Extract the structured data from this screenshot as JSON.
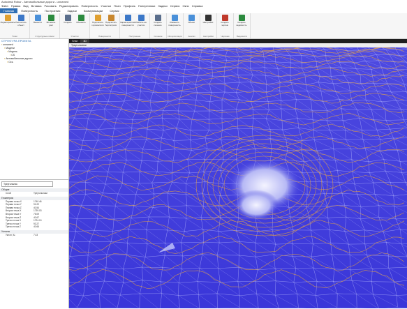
{
  "window": {
    "title": "Autodesk Robur - Автомобильные дороги - unnamed"
  },
  "menu": [
    "Файл",
    "Правка",
    "Вид",
    "Вставка",
    "Рисовать",
    "Редактировать",
    "Поверхность",
    "Участки",
    "План",
    "Профиль",
    "Поперечники",
    "Задачи",
    "Сервис",
    "Окно",
    "Справка"
  ],
  "ribbon_tabs": [
    {
      "label": "Главная",
      "active": true
    },
    {
      "label": "Поверхность",
      "active": false
    },
    {
      "label": "Построения",
      "active": false
    },
    {
      "label": "Задачи",
      "active": false
    },
    {
      "label": "Коммуникации",
      "active": false
    },
    {
      "label": "Сервис",
      "active": false
    }
  ],
  "ribbon_groups": [
    {
      "label": "Точки",
      "buttons": [
        {
          "label": "Редактировать",
          "icon": "edit-points-icon",
          "color": "#e0a030"
        },
        {
          "label": "Рассчитать объект",
          "icon": "calc-object-icon",
          "color": "#3c78c8"
        }
      ]
    },
    {
      "label": "Структурные линии",
      "buttons": [
        {
          "label": "Вынести",
          "icon": "lines-icon",
          "color": "#4a90d9"
        },
        {
          "label": "Вставить узел",
          "icon": "insert-node-icon",
          "color": "#2b8a3e"
        }
      ]
    },
    {
      "label": "Участки",
      "buttons": [
        {
          "label": "Создать",
          "icon": "create-area-icon",
          "color": "#5a6e8c"
        },
        {
          "label": "Обновить",
          "icon": "refresh-icon",
          "color": "#2b8a3e"
        }
      ]
    },
    {
      "label": "Поверхности",
      "buttons": [
        {
          "label": "Подсчитать горизонтали",
          "icon": "contours-icon",
          "color": "#e0a030"
        },
        {
          "label": "Подсчитать бергштрихи",
          "icon": "bergstrich-icon",
          "color": "#c8872e"
        }
      ]
    },
    {
      "label": "Построение",
      "buttons": [
        {
          "label": "Характеристики поверхности",
          "icon": "surface-props-icon",
          "color": "#3c78c8"
        },
        {
          "label": "Разбить на участки",
          "icon": "split-icon",
          "color": "#3c78c8"
        }
      ]
    },
    {
      "label": "Сечение",
      "buttons": [
        {
          "label": "Создать сечение",
          "icon": "section-icon",
          "color": "#5a6e8c"
        }
      ]
    },
    {
      "label": "Интерполяция",
      "buttons": [
        {
          "label": "Изменить поверхность",
          "icon": "modify-surface-icon",
          "color": "#4a90d9"
        }
      ]
    },
    {
      "label": "Анализ",
      "buttons": [
        {
          "label": "Объем",
          "icon": "volume-icon",
          "color": "#4a90d9"
        }
      ]
    },
    {
      "label": "Настройки",
      "buttons": [
        {
          "label": "Настройки",
          "icon": "gear-icon",
          "color": "#333333"
        }
      ]
    },
    {
      "label": "Чертежи",
      "buttons": [
        {
          "label": "Создать чертеж",
          "icon": "drawing-icon",
          "color": "#c0392b"
        }
      ]
    },
    {
      "label": "Ведомости",
      "buttons": [
        {
          "label": "Создать ведомость",
          "icon": "report-icon",
          "color": "#2b8a3e"
        }
      ]
    }
  ],
  "project": {
    "title": "СТРУКТУРА ПРОЕКТА",
    "tree": [
      {
        "label": "unnamed",
        "level": 0
      },
      {
        "label": "Модели",
        "level": 1
      },
      {
        "label": "Модель",
        "level": 2
      },
      {
        "label": "CS",
        "level": 3
      },
      {
        "label": "Автомобильные дороги",
        "level": 1
      },
      {
        "label": "Ось",
        "level": 2
      }
    ]
  },
  "viewport": {
    "tabs": [
      {
        "label": "План",
        "active": false
      },
      {
        "label": "3D",
        "active": true
      }
    ],
    "toolbar_label": "Треугольники"
  },
  "properties": {
    "selector": "Треугольник",
    "sections": [
      {
        "name": "Общие",
        "rows": [
          {
            "k": "Слой",
            "v": "Треугольники"
          }
        ]
      },
      {
        "name": "Геометрия",
        "rows": [
          {
            "k": "Первая точка X",
            "v": "1740.46"
          },
          {
            "k": "Первая точка Y",
            "v": "91.22"
          },
          {
            "k": "Первая точка Z",
            "v": "40.54"
          },
          {
            "k": "Вторая точка X",
            "v": "1739.03"
          },
          {
            "k": "Вторая точка Y",
            "v": "75.09"
          },
          {
            "k": "Вторая точка Z",
            "v": "40.67"
          },
          {
            "k": "Третья точка X",
            "v": "1724.10"
          },
          {
            "k": "Третья точка Y",
            "v": "93.27"
          },
          {
            "k": "Третья точка Z",
            "v": "40.66"
          }
        ]
      },
      {
        "name": "Уклоны",
        "rows": [
          {
            "k": "Уклон, ‰",
            "v": "7.43"
          }
        ]
      }
    ]
  },
  "colors": {
    "accent": "#2f6fb4",
    "terrain": "#3a36d9",
    "contour": "#e6a23c",
    "mesh": "#bfc3ff"
  }
}
